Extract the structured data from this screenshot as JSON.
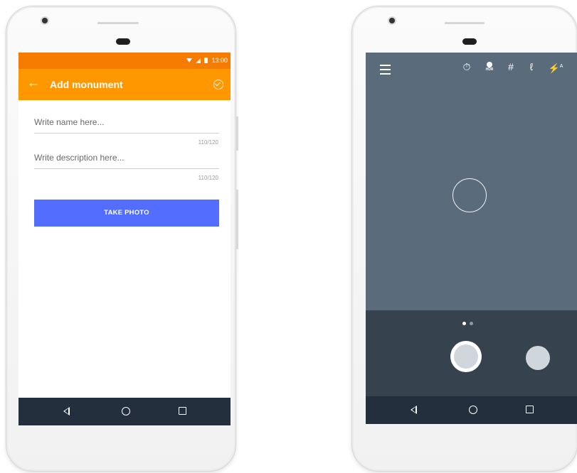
{
  "left_phone": {
    "status_bar": {
      "time": "13:00"
    },
    "app_bar": {
      "back_icon": "arrow-left-icon",
      "title": "Add monument",
      "confirm_icon": "check-circle-icon"
    },
    "form": {
      "name_placeholder": "Write name here...",
      "name_counter": "110/120",
      "description_placeholder": "Write description here...",
      "description_counter": "110/120",
      "take_photo_label": "TAKE PHOTO"
    },
    "colors": {
      "status_bar": "#f57c00",
      "app_bar": "#ff9800",
      "button": "#536dfe",
      "nav_bar": "#242f3e"
    }
  },
  "right_phone": {
    "toolbar_icons": [
      "menu-icon",
      "timer-icon",
      "hdr-icon",
      "grid-icon",
      "white-balance-icon",
      "flash-auto-icon"
    ],
    "hdr_label": "HDR",
    "flash_label": "A",
    "page_indicator": {
      "count": 2,
      "active": 0
    },
    "colors": {
      "viewfinder": "#5a6b7b",
      "controls": "#37424f",
      "shutter_inner": "#cfd6dc"
    }
  },
  "nav_bar": {
    "icons": [
      "back-icon",
      "home-icon",
      "recents-icon"
    ]
  }
}
